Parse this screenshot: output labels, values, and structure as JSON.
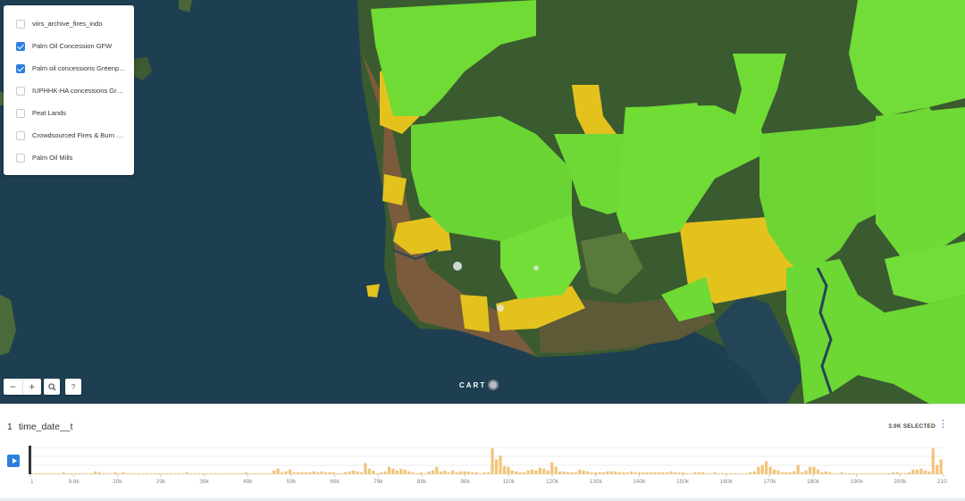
{
  "layers": [
    {
      "label": "viirs_archive_fires_indo",
      "checked": false
    },
    {
      "label": "Palm Oil Concession GFW",
      "checked": true
    },
    {
      "label": "Palm oil concessions Greenpeace",
      "checked": true
    },
    {
      "label": "IUPHHK-HA concessions Greenpeace",
      "checked": false
    },
    {
      "label": "Peat Lands",
      "checked": false
    },
    {
      "label": "Crowdsourced Fires & Burn Scars",
      "checked": false
    },
    {
      "label": "Palm Oil Mills",
      "checked": false
    }
  ],
  "map_controls": {
    "zoom_out_symbol": "−",
    "zoom_in_symbol": "+",
    "search_icon": "search-icon",
    "help_symbol": "?"
  },
  "attribution": {
    "logo_text": "CART"
  },
  "timeline": {
    "widget_number": "1",
    "title": "time_date__t",
    "selected_text": "3.0K SELECTED",
    "more_icon": "⋮",
    "play_icon": "play-icon",
    "colors": {
      "bars": "#f2c47a",
      "accent": "#2d7ee0",
      "handle": "#333333"
    }
  },
  "chart_data": {
    "type": "bar",
    "tick_labels": [
      "1",
      "9.8k",
      "20k",
      "29k",
      "39k",
      "49k",
      "59k",
      "69k",
      "79k",
      "88k",
      "98k",
      "110k",
      "120k",
      "130k",
      "140k",
      "150k",
      "160k",
      "170k",
      "180k",
      "190k",
      "200k",
      "210k"
    ],
    "x_domain": [
      1,
      213000
    ],
    "values": [
      1,
      1,
      1,
      1,
      1,
      1,
      1,
      1,
      2,
      1,
      1,
      1,
      1,
      1,
      1,
      1,
      3,
      2,
      1,
      1,
      1,
      2,
      1,
      2,
      1,
      1,
      1,
      1,
      1,
      1,
      1,
      1,
      1,
      1,
      1,
      1,
      1,
      1,
      1,
      2,
      1,
      1,
      1,
      1,
      1,
      1,
      1,
      1,
      1,
      1,
      1,
      1,
      1,
      1,
      2,
      1,
      1,
      1,
      1,
      1,
      1,
      4,
      6,
      2,
      3,
      5,
      2,
      2,
      2,
      2,
      2,
      3,
      2,
      3,
      2,
      2,
      2,
      1,
      1,
      2,
      3,
      4,
      3,
      2,
      12,
      6,
      4,
      1,
      2,
      3,
      8,
      6,
      4,
      6,
      5,
      3,
      2,
      1,
      2,
      1,
      3,
      4,
      8,
      3,
      4,
      2,
      4,
      2,
      3,
      3,
      3,
      2,
      2,
      1,
      2,
      2,
      28,
      16,
      20,
      9,
      8,
      4,
      3,
      2,
      2,
      4,
      5,
      4,
      7,
      6,
      4,
      13,
      8,
      3,
      3,
      2,
      2,
      2,
      5,
      4,
      3,
      2,
      2,
      2,
      2,
      3,
      3,
      3,
      2,
      2,
      2,
      3,
      2,
      2,
      2,
      2,
      2,
      2,
      2,
      2,
      2,
      3,
      2,
      2,
      2,
      1,
      1,
      2,
      2,
      2,
      1,
      1,
      2,
      1,
      1,
      1,
      1,
      1,
      1,
      1,
      1,
      2,
      3,
      8,
      10,
      14,
      8,
      5,
      4,
      2,
      2,
      2,
      3,
      10,
      2,
      4,
      8,
      8,
      5,
      2,
      3,
      2,
      1,
      1,
      2,
      1,
      1,
      1,
      1,
      1,
      1,
      1,
      1,
      1,
      1,
      1,
      1,
      2,
      2,
      1,
      1,
      2,
      5,
      5,
      6,
      4,
      3,
      28,
      10,
      16
    ]
  }
}
